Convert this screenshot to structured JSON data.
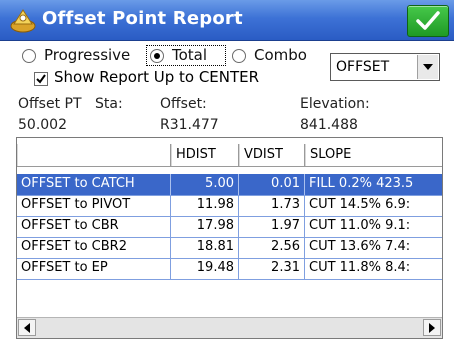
{
  "window": {
    "title": "Offset Point Report",
    "ok_icon": "checkmark-icon",
    "app_icon": "survey-app-icon",
    "colors": {
      "titlebar": "#3d72d6",
      "ok_button": "#1f9a25",
      "selection": "#3a67c9"
    }
  },
  "report_mode": {
    "options": [
      {
        "label": "Progressive",
        "selected": false
      },
      {
        "label": "Total",
        "selected": true
      },
      {
        "label": "Combo",
        "selected": false
      }
    ],
    "show_up_to_center": {
      "label": "Show Report Up to CENTER",
      "checked": true
    },
    "type_select": {
      "value": "OFFSET"
    }
  },
  "info": {
    "offset_pt_label": "Offset PT",
    "sta_label": "Sta:",
    "sta_value": "50.002",
    "offset_label": "Offset:",
    "offset_value": "R31.477",
    "elevation_label": "Elevation:",
    "elevation_value": "841.488"
  },
  "table": {
    "columns": [
      "",
      "HDIST",
      "VDIST",
      "SLOPE"
    ],
    "rows": [
      {
        "name": "OFFSET to CATCH",
        "hdist": "5.00",
        "vdist": "0.01",
        "slope": "FILL  0.2%  423.5",
        "selected": true
      },
      {
        "name": "OFFSET to PIVOT",
        "hdist": "11.98",
        "vdist": "1.73",
        "slope": "CUT  14.5%  6.9:",
        "selected": false
      },
      {
        "name": "OFFSET to CBR",
        "hdist": "17.98",
        "vdist": "1.97",
        "slope": "CUT  11.0%  9.1:",
        "selected": false
      },
      {
        "name": "OFFSET to CBR2",
        "hdist": "18.81",
        "vdist": "2.56",
        "slope": "CUT  13.6%  7.4:",
        "selected": false
      },
      {
        "name": "OFFSET to EP",
        "hdist": "19.48",
        "vdist": "2.31",
        "slope": "CUT  11.8%  8.4:",
        "selected": false
      }
    ]
  }
}
